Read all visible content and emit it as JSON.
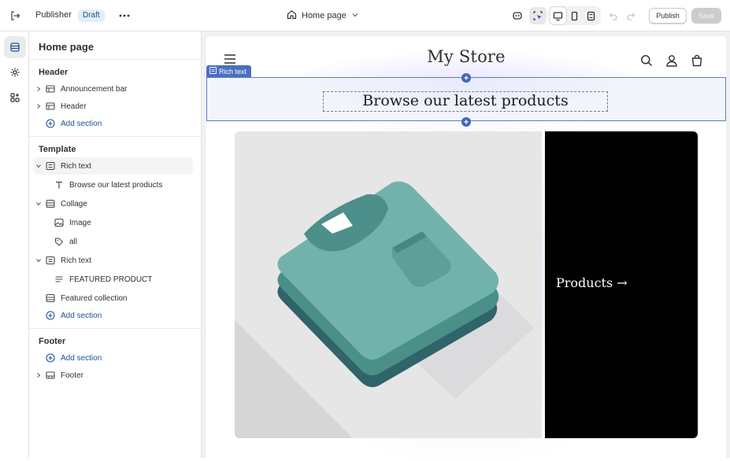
{
  "topbar": {
    "app_name": "Publisher",
    "status_badge": "Draft",
    "page_selector": "Home page",
    "publish_label": "Publish",
    "save_label": "Save"
  },
  "sidebar": {
    "title": "Home page",
    "header_group": {
      "heading": "Header",
      "items": [
        {
          "label": "Announcement bar",
          "icon": "section-layout-icon"
        },
        {
          "label": "Header",
          "icon": "section-layout-icon"
        }
      ],
      "add_label": "Add section"
    },
    "template_group": {
      "heading": "Template",
      "items": [
        {
          "label": "Rich text",
          "icon": "rich-text-icon"
        },
        {
          "label": "Browse our latest products",
          "icon": "text-icon"
        },
        {
          "label": "Collage",
          "icon": "collage-icon"
        },
        {
          "label": "Image",
          "icon": "image-icon"
        },
        {
          "label": "all",
          "icon": "tag-icon"
        },
        {
          "label": "Rich text",
          "icon": "rich-text-icon"
        },
        {
          "label": "FEATURED PRODUCT",
          "icon": "text-lines-icon"
        },
        {
          "label": "Featured collection",
          "icon": "collection-icon"
        }
      ],
      "add_label": "Add section"
    },
    "footer_group": {
      "heading": "Footer",
      "add_label": "Add section",
      "items": [
        {
          "label": "Footer",
          "icon": "footer-layout-icon"
        }
      ]
    }
  },
  "preview": {
    "store_name": "My Store",
    "selected_tag": "Rich text",
    "rich_text_heading": "Browse our latest products",
    "collage_card_text": "Products →"
  },
  "colors": {
    "accent_blue": "#3f67b8",
    "add_link": "#1f5199",
    "badge_bg": "#e4eef9",
    "tshirt_teal": "#6fb0ab",
    "card_black": "#000000"
  }
}
